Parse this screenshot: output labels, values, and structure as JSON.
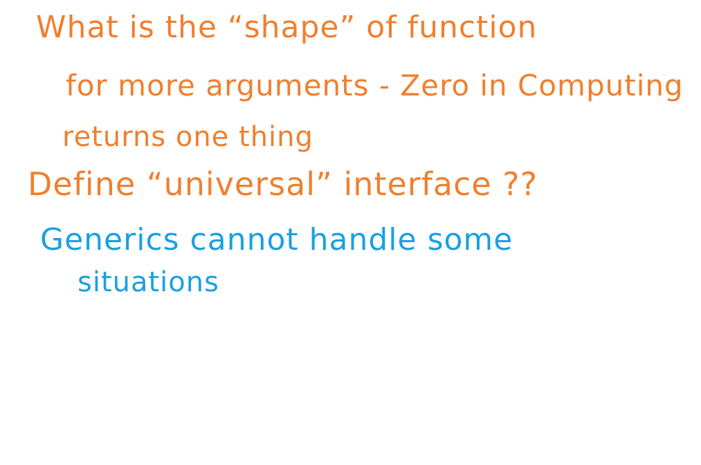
{
  "note": {
    "lines": [
      {
        "text": "What is the “shape” of function",
        "color": "#f07f2e"
      },
      {
        "text": "for more arguments - Zero in Computing",
        "color": "#f07f2e"
      },
      {
        "text": "returns one thing",
        "color": "#f07f2e"
      },
      {
        "text": "Define “universal” interface ??",
        "color": "#f07f2e"
      },
      {
        "text": "Generics cannot handle some",
        "color": "#1aa0e0"
      },
      {
        "text": "situations",
        "color": "#1aa0e0"
      }
    ]
  }
}
